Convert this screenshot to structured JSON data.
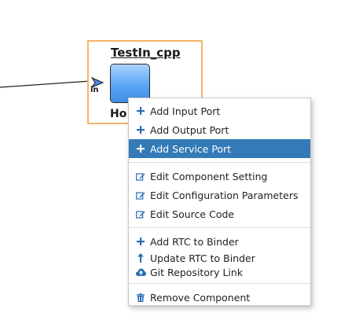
{
  "component": {
    "name": "TestIn_cpp",
    "port_label": "in",
    "host_label": "Ho"
  },
  "colors": {
    "frame": "#f5b26b",
    "body_top": "#a9d2ff",
    "body_bottom": "#3f8fe6",
    "highlight": "#337ab7",
    "icon": "#2b6fb3"
  },
  "context_menu": {
    "groups": [
      [
        {
          "icon": "plus-icon",
          "label": "Add Input Port"
        },
        {
          "icon": "plus-icon",
          "label": "Add Output Port"
        },
        {
          "icon": "plus-icon",
          "label": "Add Service Port",
          "highlighted": true
        }
      ],
      [
        {
          "icon": "edit-icon",
          "label": "Edit Component Setting"
        },
        {
          "icon": "edit-icon",
          "label": "Edit Configuration Parameters"
        },
        {
          "icon": "edit-icon",
          "label": "Edit Source Code"
        }
      ],
      [
        {
          "icon": "plus-icon",
          "label": "Add RTC to Binder"
        },
        {
          "icon": "arrow-up-icon",
          "label": "Update RTC to Binder"
        },
        {
          "icon": "cloud-upload-icon",
          "label": "Git Repository Link"
        }
      ],
      [
        {
          "icon": "trash-icon",
          "label": "Remove Component"
        }
      ]
    ]
  }
}
